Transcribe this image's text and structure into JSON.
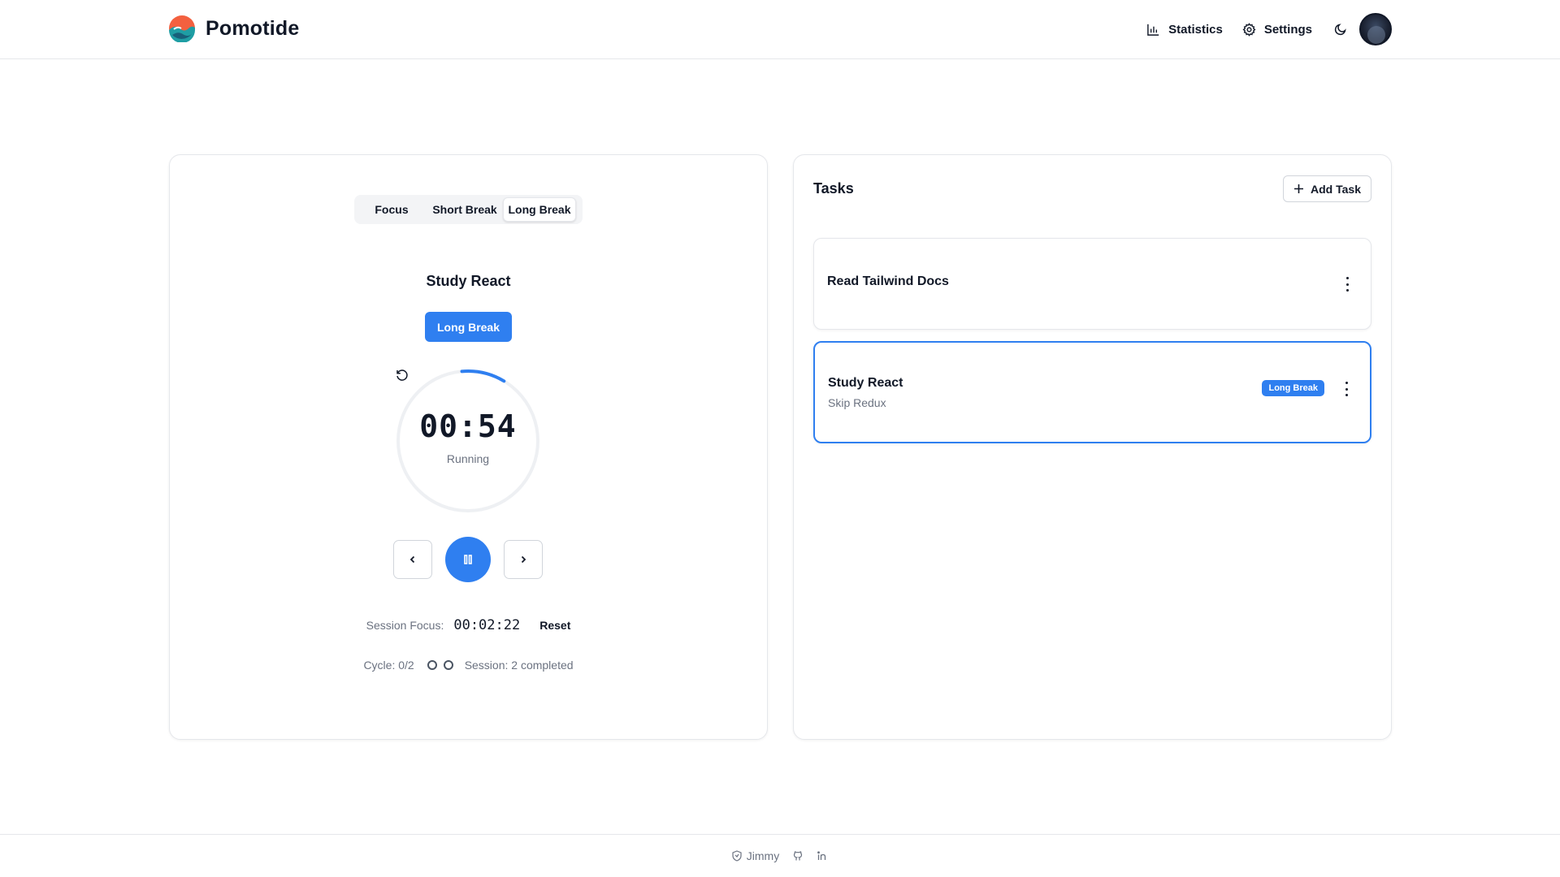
{
  "brand": {
    "name": "Pomotide"
  },
  "nav": {
    "statistics": "Statistics",
    "settings": "Settings"
  },
  "timer": {
    "modes": [
      "Focus",
      "Short Break",
      "Long Break"
    ],
    "active_mode": "Long Break",
    "current_task": "Study React",
    "badge": "Long Break",
    "time": "00:54",
    "status": "Running",
    "progress": 0.1,
    "session_focus_label": "Session Focus:",
    "session_focus_time": "00:02:22",
    "reset_label": "Reset",
    "cycle_label": "Cycle: 0/2",
    "session_label": "Session: 2 completed"
  },
  "tasks": {
    "title": "Tasks",
    "add_label": "Add Task",
    "items": [
      {
        "title": "Read Tailwind Docs",
        "subtitle": "",
        "badge": ""
      },
      {
        "title": "Study React",
        "subtitle": "Skip Redux",
        "badge": "Long Break"
      }
    ]
  },
  "footer": {
    "author": "Jimmy"
  },
  "colors": {
    "accent": "#2f7ff0",
    "border": "#e5e7eb",
    "muted": "#6b7280"
  }
}
